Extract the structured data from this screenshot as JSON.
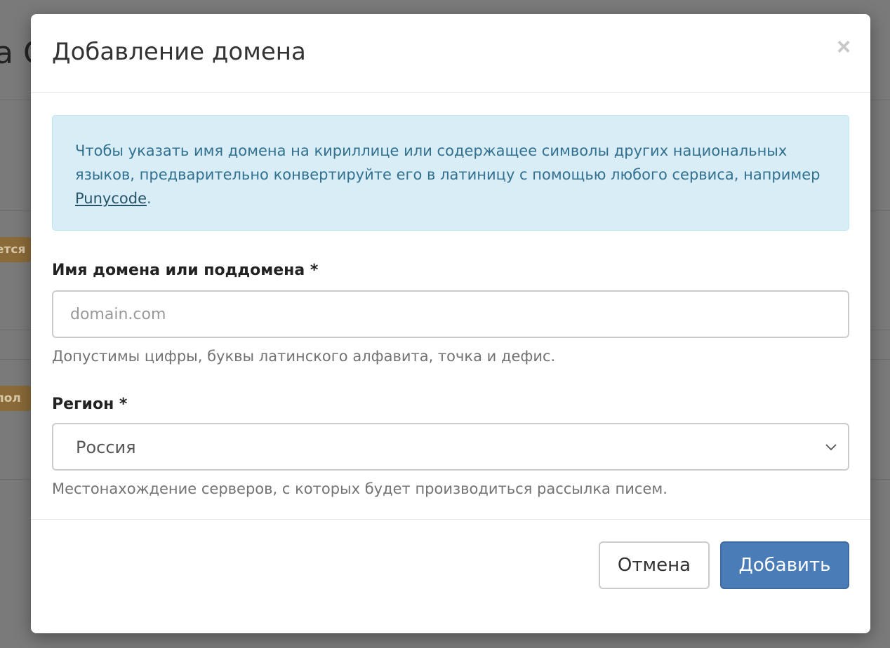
{
  "background": {
    "title_fragment": "a C",
    "badge_1": "ется",
    "badge_2": "пол"
  },
  "modal": {
    "title": "Добавление домена",
    "close_symbol": "×",
    "alert": {
      "text_before": "Чтобы указать имя домена на кириллице или содержащее символы других национальных языков, предварительно конвертируйте его в латиницу с помощью любого сервиса, например ",
      "link_text": "Punycode",
      "text_after": "."
    },
    "domain_field": {
      "label": "Имя домена или поддомена *",
      "placeholder": "domain.com",
      "value": "",
      "help": "Допустимы цифры, буквы латинского алфавита, точка и дефис."
    },
    "region_field": {
      "label": "Регион *",
      "selected": "Россия",
      "help": "Местонахождение серверов, с которых будет производиться рассылка писем."
    },
    "footer": {
      "cancel_label": "Отмена",
      "add_label": "Добавить"
    }
  },
  "colors": {
    "alert_bg": "#d9edf7",
    "alert_text": "#31708f",
    "primary": "#4a7db7"
  },
  "icons": {
    "close": "close-icon",
    "select": "chevron-down-icon"
  }
}
